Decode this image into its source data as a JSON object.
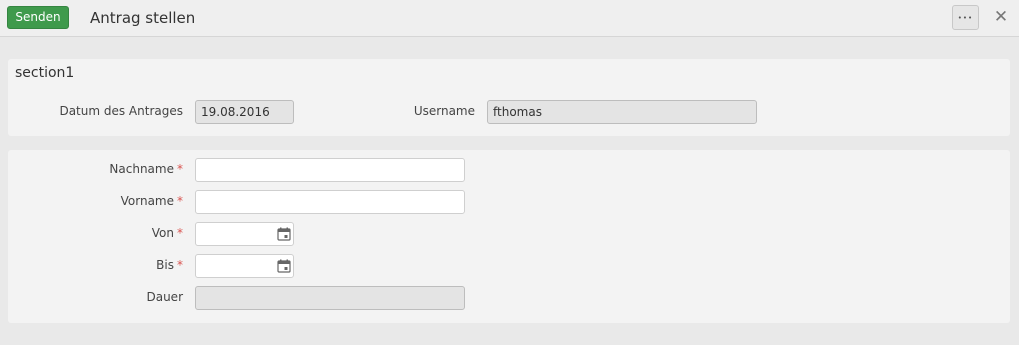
{
  "toolbar": {
    "send_label": "Senden",
    "title": "Antrag stellen",
    "more_label": "•••",
    "close_label": "✕"
  },
  "section1": {
    "title": "section1",
    "date_label": "Datum des Antrages",
    "date_value": "19.08.2016",
    "username_label": "Username",
    "username_value": "fthomas"
  },
  "form": {
    "nachname_label": "Nachname",
    "vorname_label": "Vorname",
    "von_label": "Von",
    "bis_label": "Bis",
    "dauer_label": "Dauer",
    "required_marker": "*"
  },
  "colors": {
    "send_button": "#3f9a4c",
    "required": "#d9534f",
    "readonly_field": "#e4e4e4"
  }
}
